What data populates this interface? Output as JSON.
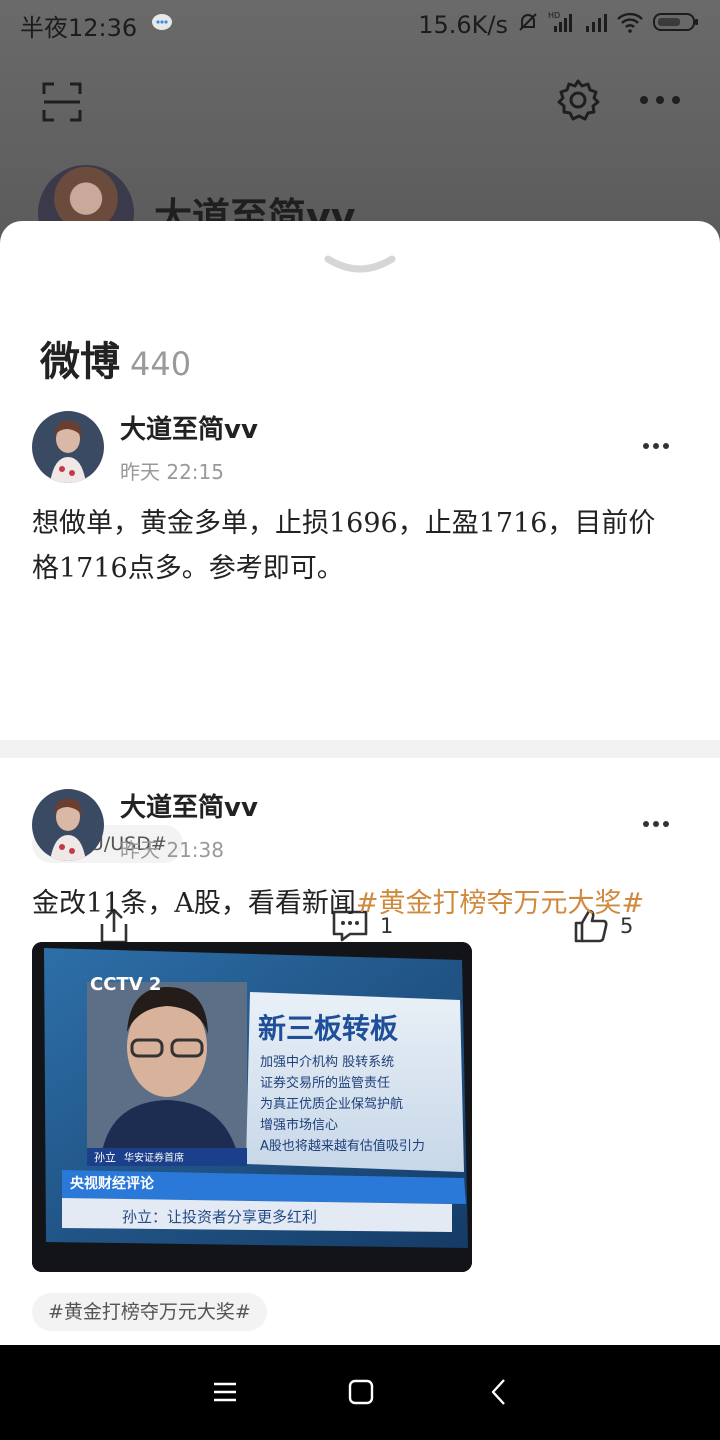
{
  "status_bar": {
    "time": "半夜12:36",
    "speed": "15.6K/s"
  },
  "profile": {
    "name": "大道至简vv"
  },
  "section": {
    "title": "微博",
    "count": "440"
  },
  "posts": [
    {
      "author": "大道至简vv",
      "time": "昨天 22:15",
      "text": "想做单，黄金多单，止损1696，止盈1716，目前价格1716点多。参考即可。",
      "tag": "#XAU/USD#",
      "comments": "1",
      "likes": "5"
    },
    {
      "author": "大道至简vv",
      "time": "昨天 21:38",
      "text": "金改11条，A股，看看新闻",
      "topic": "#黄金打榜夺万元大奖#",
      "image": {
        "channel": "CCTV 2",
        "headline": "新三板转板",
        "lines": [
          "加强中介机构 股转系统",
          "证券交易所的监管责任",
          "为真正优质企业保驾护航",
          "增强市场信心",
          "A股也将越来越有估值吸引力"
        ],
        "speaker": "孙立",
        "speaker_title": "华安证券首席",
        "program": "央视财经评论",
        "quote": "孙立：让投资者分享更多红利"
      },
      "tag": "#黄金打榜夺万元大奖#"
    }
  ],
  "icons": {
    "scan": "scan-icon",
    "settings": "gear-icon",
    "more": "more-icon",
    "collapse": "chevron-down-icon",
    "share": "share-icon",
    "comment": "comment-icon",
    "like": "like-icon",
    "nav_menu": "menu-icon",
    "nav_home": "home-icon",
    "nav_back": "back-icon"
  },
  "colors": {
    "topic": "#d08a3f",
    "divider": "#f2f2f2",
    "tag_bg": "#f3f3f3"
  }
}
